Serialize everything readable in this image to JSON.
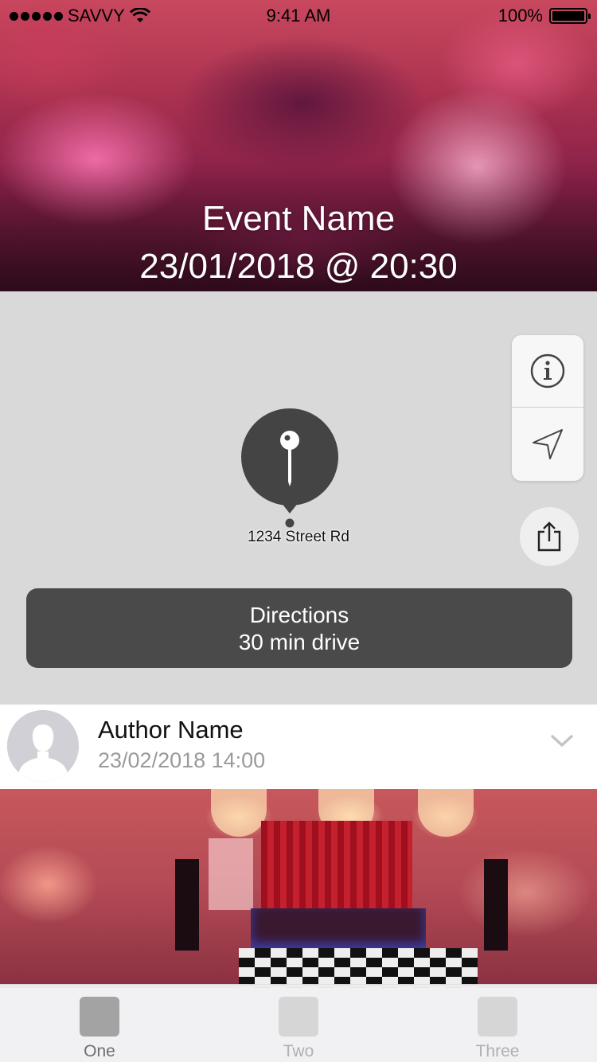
{
  "status_bar": {
    "carrier": "SAVVY",
    "time": "9:41 AM",
    "battery": "100%",
    "battery_level": 1.0
  },
  "event": {
    "name": "Event Name",
    "datetime": "23/01/2018 @ 20:30"
  },
  "map": {
    "address": "1234 Street Rd",
    "controls": {
      "info_icon": "info-circle-icon",
      "locate_icon": "location-arrow-icon",
      "share_icon": "share-icon"
    },
    "pin_icon": "map-pin-icon"
  },
  "directions": {
    "title": "Directions",
    "subtitle": "30 min drive"
  },
  "post": {
    "author": "Author Name",
    "timestamp": "23/02/2018 14:00",
    "avatar_icon": "avatar-placeholder-icon",
    "menu_icon": "chevron-down-icon"
  },
  "tabs": [
    {
      "label": "One",
      "active": true
    },
    {
      "label": "Two",
      "active": false
    },
    {
      "label": "Three",
      "active": false
    }
  ],
  "colors": {
    "map_background": "#d9d9d9",
    "button_dark": "#4a4a4a",
    "tab_active": "#a3a3a3",
    "tab_inactive": "#d6d6d6"
  }
}
